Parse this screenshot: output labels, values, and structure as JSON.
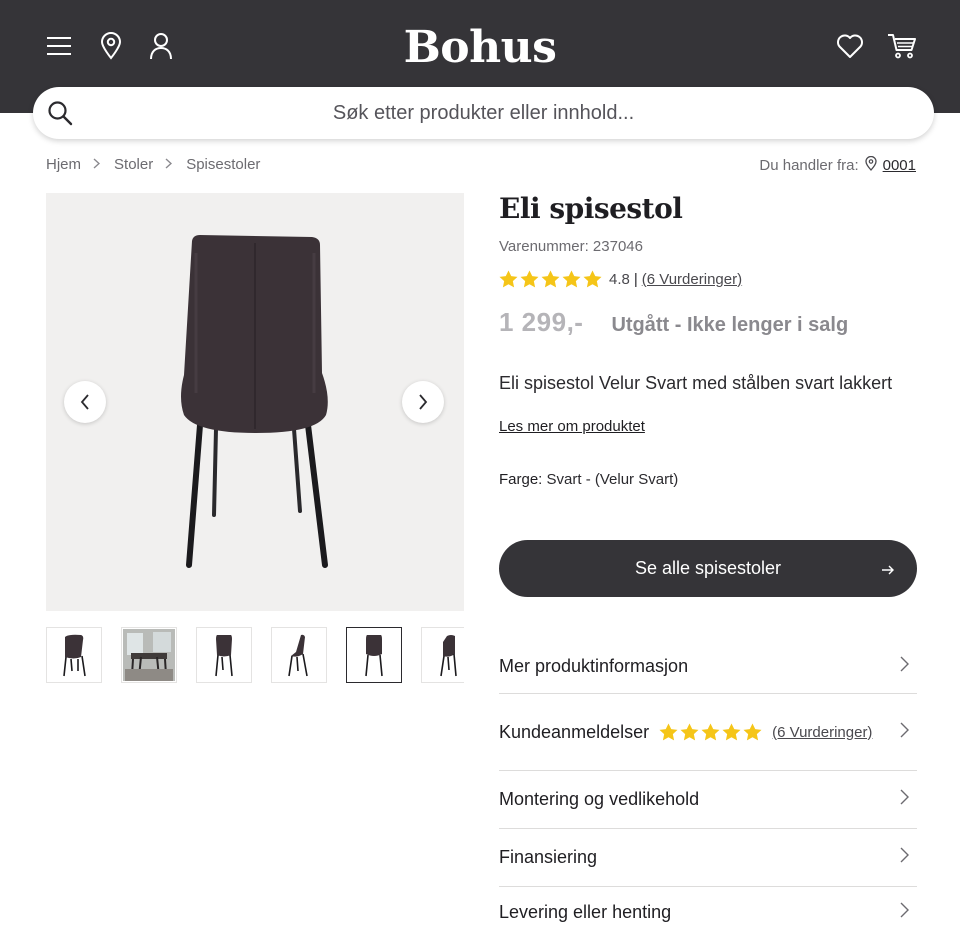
{
  "header": {
    "logo": "Bohus",
    "search_placeholder": "Søk etter produkter eller innhold..."
  },
  "breadcrumb": {
    "items": [
      "Hjem",
      "Stoler",
      "Spisestoler"
    ]
  },
  "store": {
    "label": "Du handler fra:",
    "store_id": "0001"
  },
  "product": {
    "title": "Eli spisestol",
    "sku_label": "Varenummer: 237046",
    "rating": {
      "score": "4.8",
      "reviews_link": "(6 Vurderinger)",
      "stars": 5
    },
    "price": "1 299,-",
    "status": "Utgått - Ikke lenger i salg",
    "description": "Eli spisestol Velur Svart med stålben svart lakkert",
    "more_link": "Les mer om produktet",
    "color_label": "Farge:",
    "color_value": "Svart - (Velur Svart)",
    "cta_label": "Se alle spisestoler"
  },
  "gallery": {
    "active_thumbnail": 5,
    "thumbnail_count": 6
  },
  "accordion": {
    "items": [
      {
        "label": "Mer produktinformasjon"
      },
      {
        "label": "Kundeanmeldelser",
        "reviews_link": "(6 Vurderinger)"
      },
      {
        "label": "Montering og vedlikehold"
      },
      {
        "label": "Finansiering"
      },
      {
        "label": "Levering eller henting"
      }
    ]
  },
  "colors": {
    "header_bg": "#353438",
    "star": "#f5c518",
    "cta_bg": "#353438"
  }
}
